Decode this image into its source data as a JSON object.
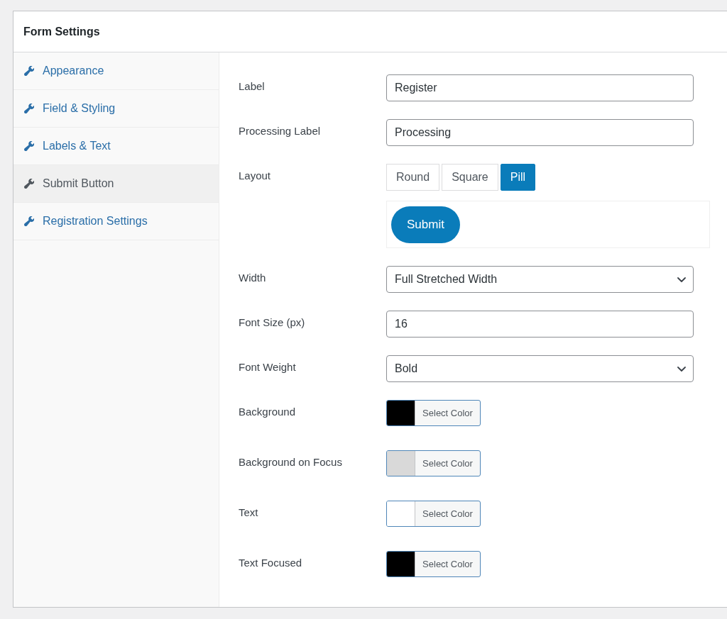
{
  "panel": {
    "title": "Form Settings"
  },
  "sidebar": {
    "items": [
      {
        "label": "Appearance",
        "selected": false
      },
      {
        "label": "Field & Styling",
        "selected": false
      },
      {
        "label": "Labels & Text",
        "selected": false
      },
      {
        "label": "Submit Button",
        "selected": true
      },
      {
        "label": "Registration Settings",
        "selected": false
      }
    ]
  },
  "settings": [
    {
      "kind": "text",
      "label": "Label",
      "value": "Register"
    },
    {
      "kind": "text",
      "label": "Processing Label",
      "value": "Processing"
    },
    {
      "kind": "layout",
      "label": "Layout",
      "options": [
        {
          "label": "Round",
          "selected": false
        },
        {
          "label": "Square",
          "selected": false
        },
        {
          "label": "Pill",
          "selected": true
        }
      ],
      "preview": {
        "label": "Submit"
      }
    },
    {
      "kind": "select",
      "label": "Width",
      "value": "Full Stretched Width"
    },
    {
      "kind": "text",
      "label": "Font Size (px)",
      "value": "16"
    },
    {
      "kind": "select",
      "label": "Font Weight",
      "value": "Bold"
    },
    {
      "kind": "color",
      "label": "Background",
      "color": "#000000",
      "button": "Select Color"
    },
    {
      "kind": "color",
      "label": "Background on Focus",
      "color": "#d9d9d9",
      "button": "Select Color"
    },
    {
      "kind": "color",
      "label": "Text",
      "color": "#ffffff",
      "button": "Select Color"
    },
    {
      "kind": "color",
      "label": "Text Focused",
      "color": "#000000",
      "button": "Select Color"
    }
  ]
}
